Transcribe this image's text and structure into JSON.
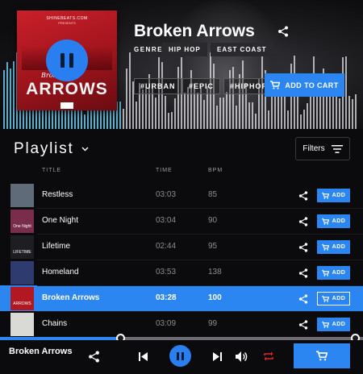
{
  "hero": {
    "title": "Broken Arrows",
    "genre_label": "GENRE",
    "genres": [
      "HIP HOP",
      "EAST COAST"
    ],
    "tags": [
      "#URBAN",
      "#EPIC",
      "#HIPHOP"
    ],
    "add_to_cart": "ADD TO CART",
    "cover": {
      "site": "SHINEBEATS.COM",
      "sub": "PRESENTS",
      "small_title": "Broken",
      "big_title": "ARROWS"
    }
  },
  "playlist": {
    "title": "Playlist",
    "filters_label": "Filters",
    "columns": {
      "title": "TITLE",
      "time": "TIME",
      "bpm": "BPM"
    },
    "add_label": "ADD",
    "tracks": [
      {
        "name": "Restless",
        "time": "03:03",
        "bpm": "85",
        "thumb_color": "#5f6b78",
        "thumb_text": ""
      },
      {
        "name": "One Night",
        "time": "03:04",
        "bpm": "90",
        "thumb_color": "#7a2d4b",
        "thumb_text": "One Night"
      },
      {
        "name": "Lifetime",
        "time": "02:44",
        "bpm": "95",
        "thumb_color": "#1d1d22",
        "thumb_text": "LIFETIME"
      },
      {
        "name": "Homeland",
        "time": "03:53",
        "bpm": "138",
        "thumb_color": "#2e3b6e",
        "thumb_text": ""
      },
      {
        "name": "Broken Arrows",
        "time": "03:28",
        "bpm": "100",
        "thumb_color": "#b11822",
        "thumb_text": "ARROWS"
      },
      {
        "name": "Chains",
        "time": "03:09",
        "bpm": "99",
        "thumb_color": "#d9d9d6",
        "thumb_text": ""
      }
    ],
    "active_index": 4
  },
  "player": {
    "now_playing": "Broken Arrows",
    "progress": 0.33
  },
  "colors": {
    "accent": "#2c86f2",
    "repeat_active": "#e0262b"
  }
}
